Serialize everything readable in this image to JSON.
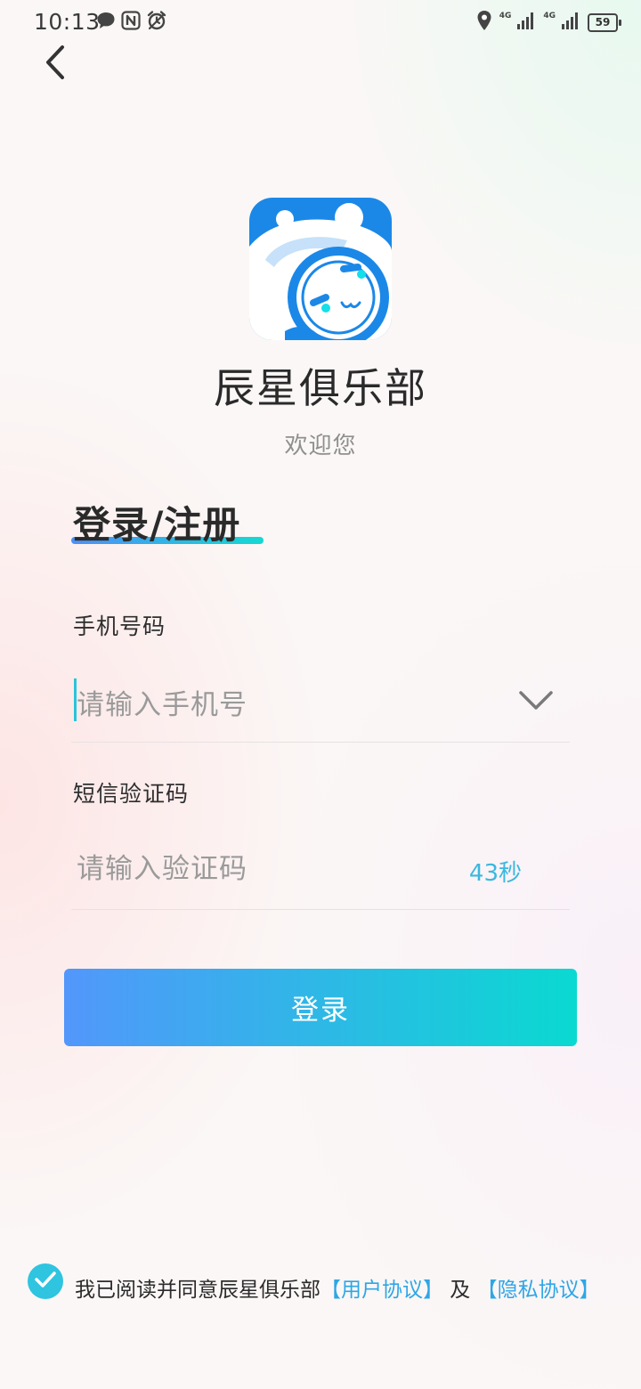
{
  "status_bar": {
    "time": "10:13",
    "network_1": "4G",
    "network_2": "4G",
    "battery": "59",
    "icons": [
      "message-icon",
      "nfc-icon",
      "alarm-icon",
      "location-icon",
      "signal-icon",
      "signal-icon",
      "battery-icon"
    ]
  },
  "header": {
    "back_icon": "chevron-left-icon"
  },
  "brand": {
    "app_name": "辰星俱乐部",
    "welcome": "欢迎您",
    "logo_colors": [
      "#1b88e8",
      "#ffffff",
      "#15dfe8"
    ]
  },
  "form": {
    "title": "登录/注册",
    "phone_label": "手机号码",
    "phone_value": "",
    "phone_placeholder": "请输入手机号",
    "code_label": "短信验证码",
    "code_value": "",
    "code_placeholder": "请输入验证码",
    "countdown": "43秒",
    "login_button": "登录",
    "accent_colors": [
      "#4f8ff7",
      "#14d9d2"
    ]
  },
  "agreement": {
    "checked": true,
    "text": "我已阅读并同意辰星俱乐部",
    "user_agreement": "【用户协议】",
    "and": " 及 ",
    "privacy_agreement": "【隐私协议】"
  }
}
